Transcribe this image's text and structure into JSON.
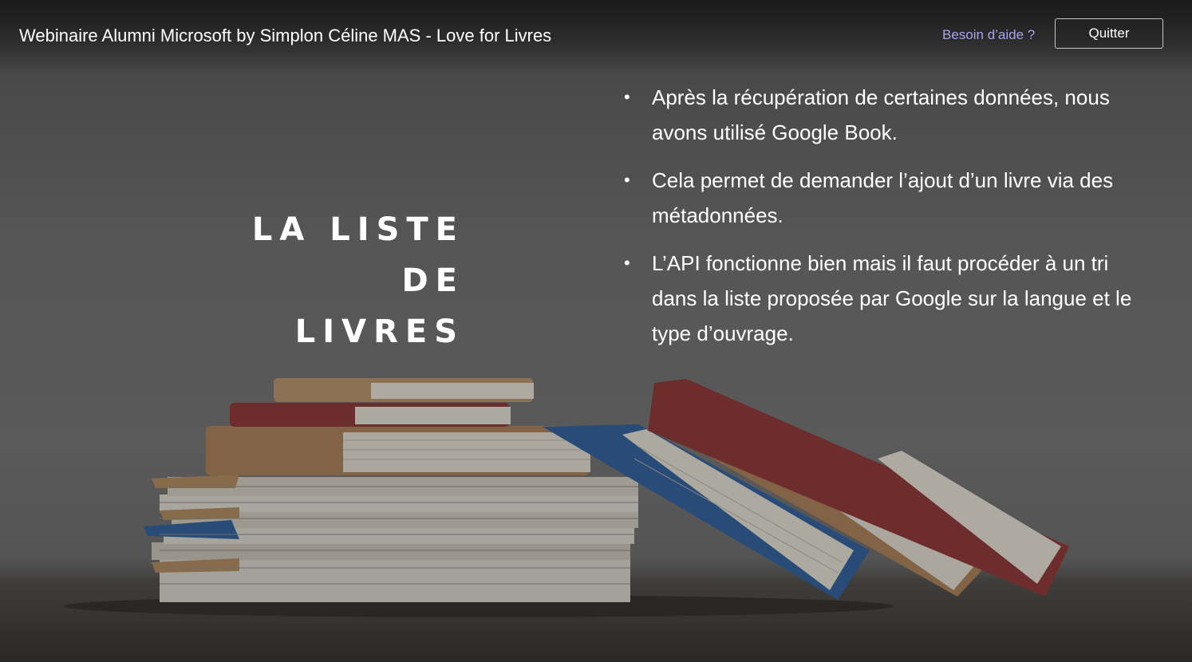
{
  "window": {
    "title": "Webinaire Alumni Microsoft by Simplon Céline MAS - Love for Livres",
    "help_link": "Besoin d’aide ?",
    "quit_label": "Quitter"
  },
  "slide": {
    "title_lines": [
      "LA LISTE DE",
      "LIVRES"
    ],
    "bullets": [
      "Après la récupération de certaines données, nous avons utilisé Google Book.",
      "Cela permet de demander l’ajout d’un livre via des métadonnées.",
      " L’API fonctionne bien mais il faut procéder à un tri dans la liste proposée par Google sur la langue et le type d’ouvrage."
    ],
    "bullet_glyph": "•"
  },
  "colors": {
    "link": "#a9a3f0",
    "text": "#ffffff",
    "book_red": "#8e3434",
    "book_blue": "#2d5f9a",
    "book_tan": "#a97f56"
  }
}
